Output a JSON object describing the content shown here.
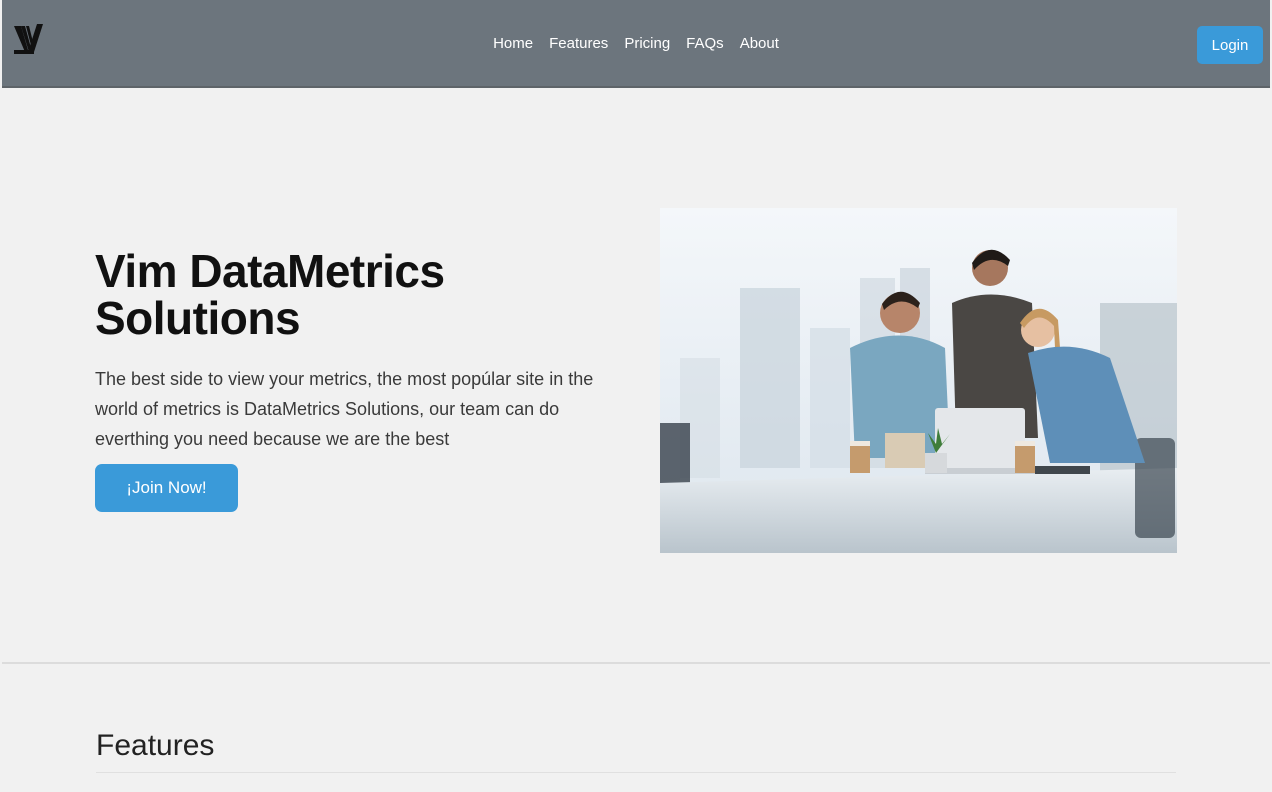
{
  "navbar": {
    "logo_icon": "v-logo-icon",
    "links": [
      {
        "label": "Home"
      },
      {
        "label": "Features"
      },
      {
        "label": "Pricing"
      },
      {
        "label": "FAQs"
      },
      {
        "label": "About"
      }
    ],
    "login_label": "Login"
  },
  "hero": {
    "title": "Vim DataMetrics Solutions",
    "text": "The best side to view your metrics, the most popúlar site in the world of metrics is DataMetrics Solutions, our team can do everthing you need because we are the best",
    "cta_label": "¡Join Now!",
    "image_icon": "team-meeting-photo"
  },
  "features": {
    "title": "Features"
  },
  "colors": {
    "navbar_bg": "#6c757d",
    "accent": "#3a9ad9",
    "page_bg": "#f1f1f1"
  }
}
